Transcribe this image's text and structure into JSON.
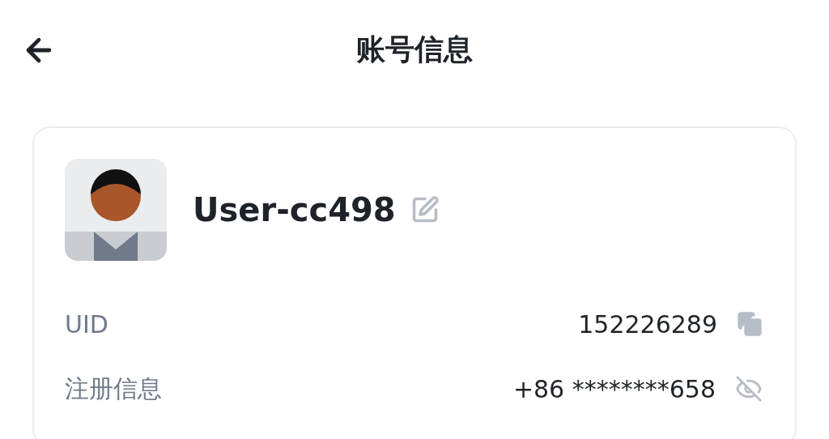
{
  "header": {
    "title": "账号信息"
  },
  "profile": {
    "username": "User-cc498"
  },
  "rows": [
    {
      "kind": "copy",
      "label": "UID",
      "value": "152226289"
    },
    {
      "kind": "hidden",
      "label": "注册信息",
      "value": "+86 ********658"
    }
  ]
}
